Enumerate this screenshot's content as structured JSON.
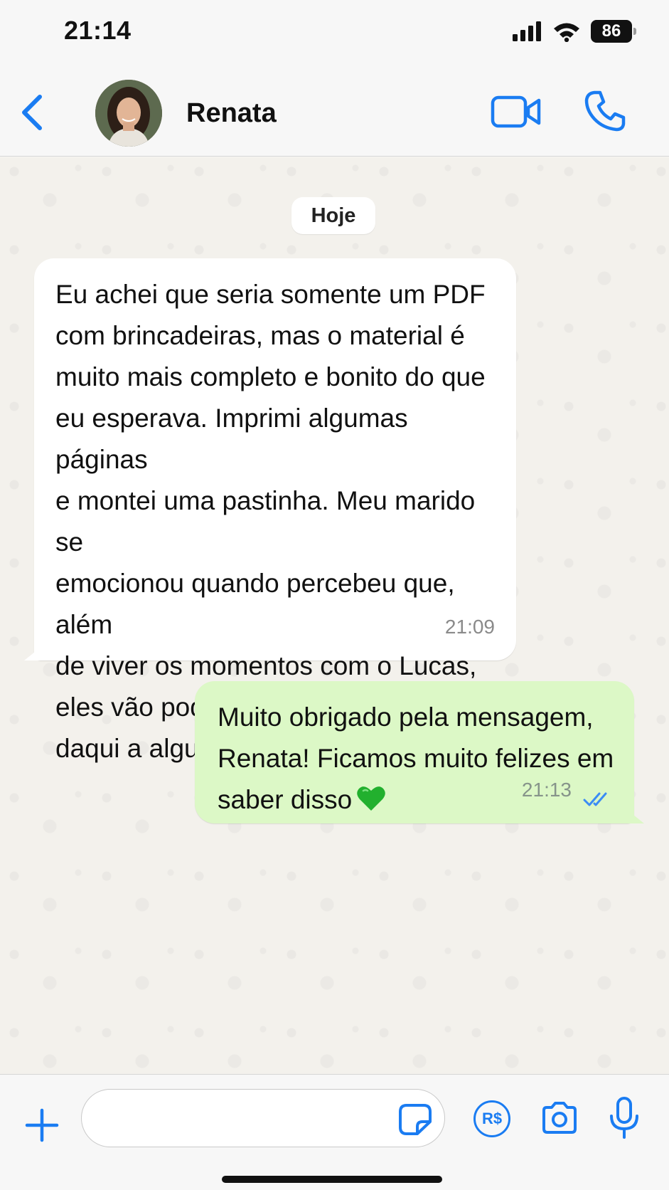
{
  "status_bar": {
    "time": "21:14",
    "battery": "86",
    "icons": [
      "signal-icon",
      "wifi-icon",
      "battery-icon"
    ]
  },
  "header": {
    "contact_name": "Renata",
    "icons": [
      "back-icon",
      "avatar",
      "video-call-icon",
      "phone-icon"
    ],
    "accent_color": "#1a7cf2"
  },
  "chat": {
    "date_label": "Hoje",
    "messages": [
      {
        "direction": "incoming",
        "text": "Eu achei que seria somente um PDF\ncom brincadeiras, mas o material é\nmuito mais completo e bonito do que\neu esperava. Imprimi algumas páginas\ne montei uma pastinha. Meu marido se\nemocionou quando percebeu que, além\nde viver os momentos com o Lucas,\neles vão poder olhar tudo novamente\ndaqui a alguns anos.",
        "time": "21:09",
        "bubble_color": "#ffffff"
      },
      {
        "direction": "outgoing",
        "text": "Muito obrigado pela mensagem,\nRenata! Ficamos muito felizes em\nsaber disso",
        "emoji": "green-heart",
        "time": "21:13",
        "status_icon": "double-check-read-icon",
        "bubble_color": "#dcf8c6"
      }
    ]
  },
  "input_bar": {
    "message_value": "",
    "payment_label": "R$",
    "icons": [
      "plus-icon",
      "sticker-icon",
      "payment-icon",
      "camera-icon",
      "microphone-icon"
    ]
  }
}
